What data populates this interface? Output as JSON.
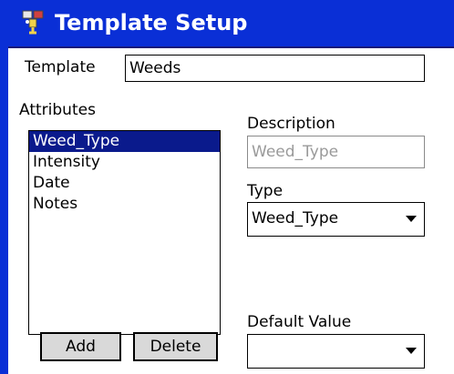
{
  "window": {
    "title": "Template Setup",
    "icon": "template-setup-app-icon",
    "accent_color": "#0a2fd6"
  },
  "template": {
    "label": "Template",
    "value": "Weeds"
  },
  "attributes": {
    "label": "Attributes",
    "items": [
      "Weed_Type",
      "Intensity",
      "Date",
      "Notes"
    ],
    "selected": "Weed_Type",
    "selection_color": "#0a1a8c"
  },
  "description": {
    "label": "Description",
    "value": "Weed_Type"
  },
  "type": {
    "label": "Type",
    "value": "Weed_Type"
  },
  "default_value": {
    "label": "Default Value",
    "value": ""
  },
  "buttons": {
    "add": "Add",
    "delete": "Delete"
  }
}
